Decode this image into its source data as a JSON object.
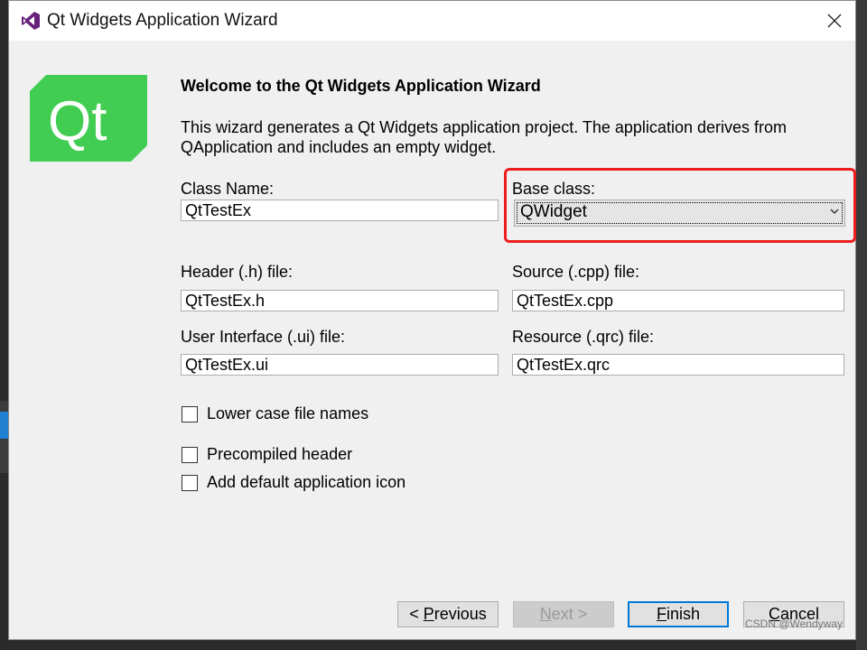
{
  "window": {
    "title": "Qt Widgets Application Wizard",
    "close_symbol": "✕",
    "icon": "visual-studio-icon"
  },
  "logo": {
    "text": "Qt",
    "color": "#41cd52"
  },
  "wizard": {
    "heading": "Welcome to the Qt Widgets Application Wizard",
    "description": "This wizard generates a Qt Widgets application project. The application derives from QApplication and includes an empty widget."
  },
  "fields": {
    "class_name": {
      "label": "Class Name:",
      "value": "QtTestEx"
    },
    "base_class": {
      "label": "Base class:",
      "value": "QWidget"
    },
    "header_file": {
      "label": "Header (.h) file:",
      "value": "QtTestEx.h"
    },
    "source_file": {
      "label": "Source (.cpp) file:",
      "value": "QtTestEx.cpp"
    },
    "ui_file": {
      "label": "User Interface (.ui) file:",
      "value": "QtTestEx.ui"
    },
    "resource_file": {
      "label": "Resource (.qrc) file:",
      "value": "QtTestEx.qrc"
    }
  },
  "options": {
    "lower_case": {
      "label": "Lower case file names",
      "checked": false
    },
    "precompiled_header": {
      "label": "Precompiled header",
      "checked": false
    },
    "default_icon": {
      "label": "Add default application icon",
      "checked": false
    }
  },
  "buttons": {
    "previous": {
      "prefix": "< ",
      "mnemonic": "P",
      "rest": "revious"
    },
    "next": {
      "mnemonic": "N",
      "rest": "ext >"
    },
    "finish": {
      "mnemonic": "F",
      "rest": "inish"
    },
    "cancel": {
      "mnemonic": "C",
      "rest": "ancel"
    }
  },
  "highlight_color": "#ee1d1d",
  "watermark": "CSDN @Wendyway"
}
